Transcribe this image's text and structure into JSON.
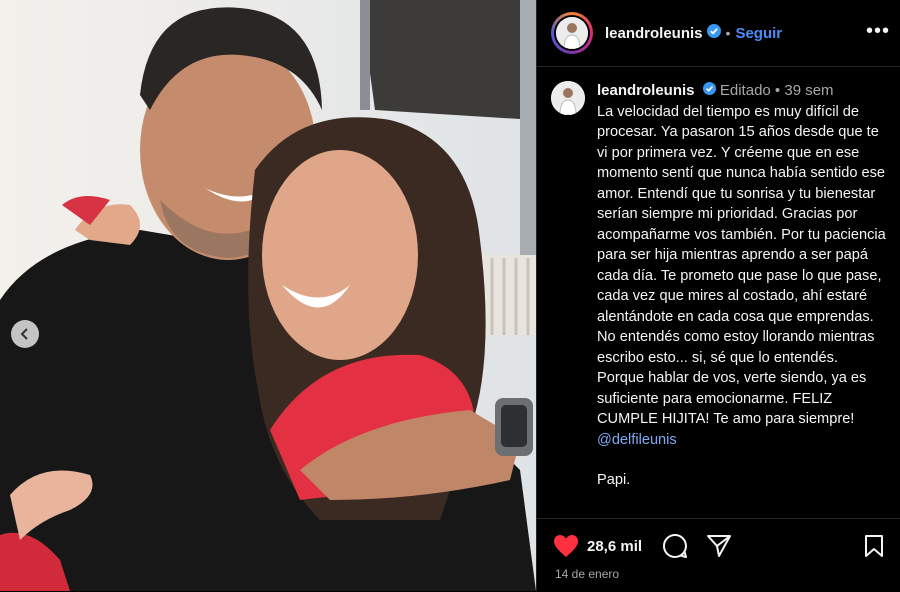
{
  "post": {
    "username": "leandroleunis",
    "follow_label": "Seguir",
    "more_label": "•••",
    "dot": "•"
  },
  "caption": {
    "username": "leandroleunis",
    "edited": "Editado",
    "age": "39 sem",
    "text": "La velocidad del tiempo es muy difícil de procesar. Ya pasaron 15 años desde que te vi por primera vez. Y créeme que en ese momento sentí que nunca había sentido ese amor. Entendí que tu sonrisa y tu bienestar serían siempre mi prioridad. Gracias por acompañarme vos también. Por tu paciencia para ser hija mientras aprendo a ser papá cada día. Te prometo que pase lo que pase, cada vez que mires al costado, ahí estaré alentándote en cada cosa que emprendas. No entendés como estoy llorando mientras escribo esto... si, sé que lo entendés. Porque hablar de vos, verte siendo, ya es suficiente para emocionarme. FELIZ CUMPLE HIJITA! Te amo para siempre!",
    "mention": "@delfileunis",
    "signature": "Papi."
  },
  "stats": {
    "likes": "28,6 mil",
    "date": "14 de enero"
  },
  "colors": {
    "like_red": "#ff3040",
    "link_blue": "#4a8df8",
    "verified_blue": "#3897f0"
  },
  "icons": [
    "chevron-left-icon",
    "verified-badge-icon",
    "more-icon",
    "heart-icon",
    "comment-icon",
    "share-icon",
    "bookmark-icon"
  ]
}
